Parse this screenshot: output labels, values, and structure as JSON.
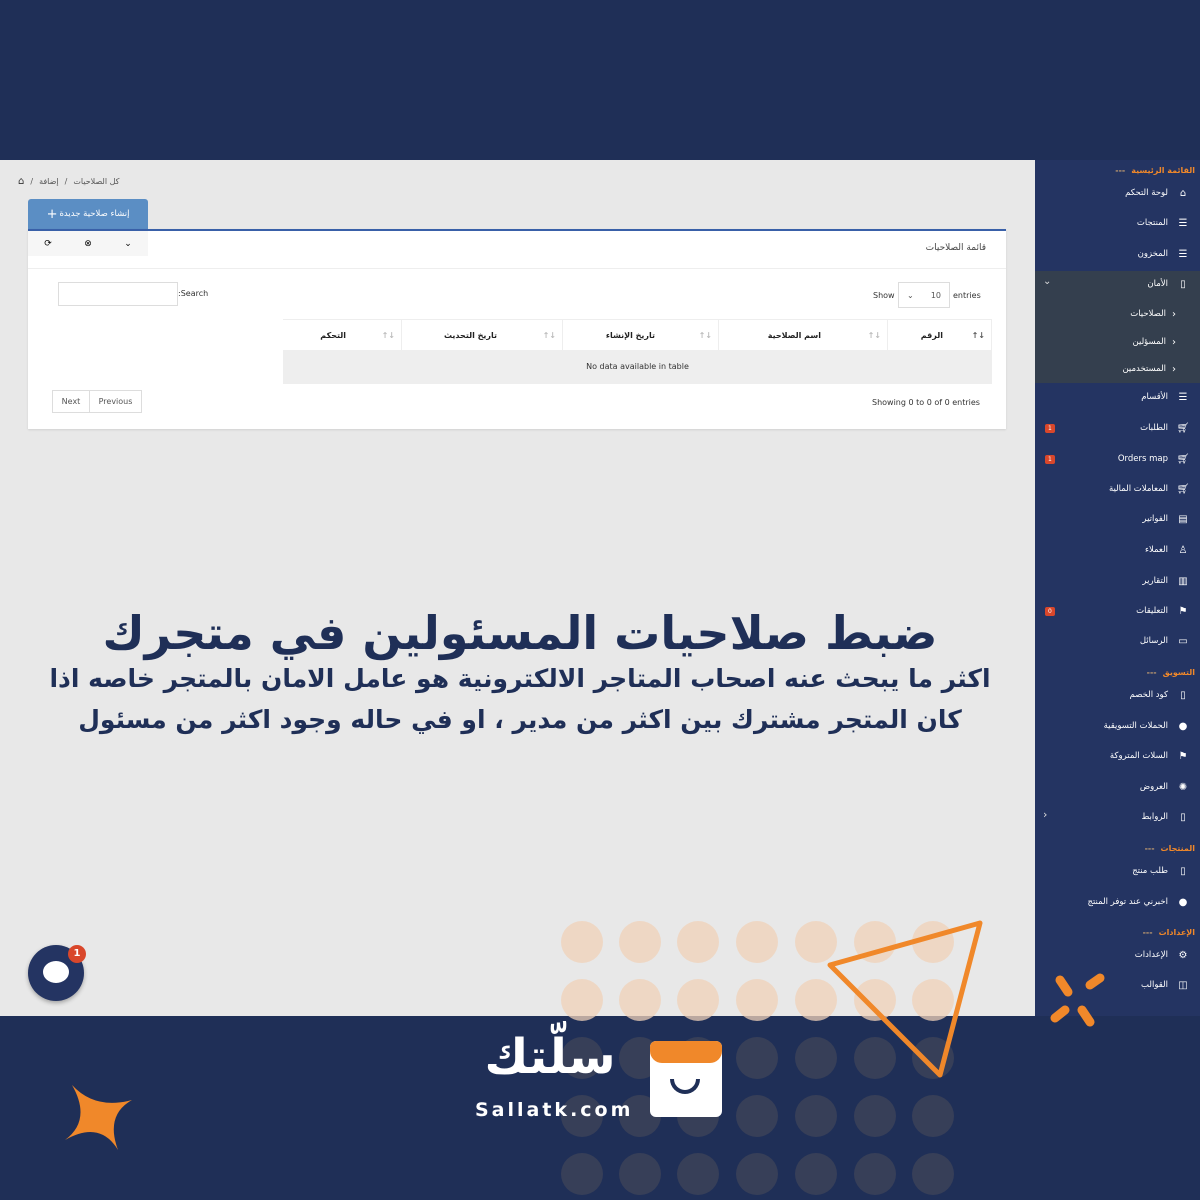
{
  "breadcrumb": {
    "home_icon": "home-icon",
    "items": [
      "إضافة",
      "كل الصلاحيات"
    ]
  },
  "create_button": "إنشاء صلاحية جديدة",
  "toolbar": {
    "icons": [
      "refresh-icon",
      "close-circle-icon",
      "chevron-down-icon"
    ]
  },
  "card": {
    "title": "قائمة الصلاحيات"
  },
  "table": {
    "show_label": "Show",
    "entries_label": "entries",
    "page_size": "10",
    "search_label": ":Search",
    "search_value": "",
    "columns": [
      "الرقم",
      "اسم الصلاحية",
      "تاريخ الإنشاء",
      "تاريخ التحديث",
      "التحكم"
    ],
    "empty": "No data available in table",
    "info": "Showing 0 to 0 of 0 entries",
    "next": "Next",
    "previous": "Previous"
  },
  "sidebar": {
    "headers": [
      "القائمة الرئيسية",
      "التسويق",
      "المنتجات",
      "الإعدادات"
    ],
    "items": [
      {
        "label": "لوحة التحكم",
        "icon": "home-icon"
      },
      {
        "label": "المنتجات",
        "icon": "list-icon"
      },
      {
        "label": "المخزون",
        "icon": "list-icon"
      },
      {
        "label": "الأمان",
        "icon": "phone-icon"
      },
      {
        "label": "الصلاحيات",
        "icon": "chevron-left-icon"
      },
      {
        "label": "المسؤلين",
        "icon": "chevron-left-icon"
      },
      {
        "label": "المستخدمين",
        "icon": "chevron-left-icon"
      },
      {
        "label": "الأقسام",
        "icon": "list-icon"
      },
      {
        "label": "الطلبات",
        "icon": "cart-icon",
        "badge": "1"
      },
      {
        "label": "Orders map",
        "icon": "cart-icon",
        "badge": "1"
      },
      {
        "label": "المعاملات المالية",
        "icon": "cart-icon"
      },
      {
        "label": "الفواتير",
        "icon": "invoice-icon"
      },
      {
        "label": "العملاء",
        "icon": "user-icon"
      },
      {
        "label": "التقارير",
        "icon": "bar-chart-icon"
      },
      {
        "label": "التعليقات",
        "icon": "flag-icon",
        "badge": "0"
      },
      {
        "label": "الرسائل",
        "icon": "message-icon"
      },
      {
        "label": "كود الخصم",
        "icon": "phone-icon"
      },
      {
        "label": "الحملات التسويقية",
        "icon": "send-icon"
      },
      {
        "label": "السلات المتروكة",
        "icon": "flag-icon"
      },
      {
        "label": "العروض",
        "icon": "badge-icon"
      },
      {
        "label": "الروابط",
        "icon": "phone-icon"
      },
      {
        "label": "طلب منتج",
        "icon": "phone-icon"
      },
      {
        "label": "اخبرني عند توفر المنتج",
        "icon": "send-icon"
      },
      {
        "label": "الإعدادات",
        "icon": "gear-icon"
      },
      {
        "label": "القوالب",
        "icon": "layout-icon"
      }
    ]
  },
  "chat": {
    "badge": "1"
  },
  "headline": {
    "title": "ضبط صلاحيات المسئولين في متجرك",
    "line1": "اكثر ما يبحث عنه اصحاب المتاجر الالكترونية هو عامل الامان بالمتجر خاصه اذا",
    "line2": "كان المتجر مشترك بين اكثر من مدير ، او في حاله وجود اكثر من مسئول"
  },
  "brand": {
    "name_ar": "سلّتك",
    "domain": "Sallatk.com"
  },
  "colors": {
    "navy": "#1f2f57",
    "accent": "#f0882a",
    "button": "#5b8ec4",
    "badge": "#d9472b"
  }
}
